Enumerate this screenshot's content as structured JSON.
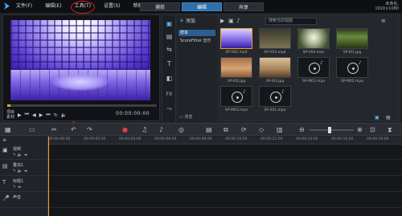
{
  "menu": [
    "文件(F)",
    "编辑(E)",
    "工具(T)",
    "设置(S)",
    "帮助(H)"
  ],
  "tabs": [
    "捕获",
    "编辑",
    "共享"
  ],
  "active_tab": "编辑",
  "title_right": [
    "未命名,",
    "1920×1080"
  ],
  "preview": {
    "labels": [
      "项目",
      "素材"
    ],
    "timecode": "00:00:00:00"
  },
  "library": {
    "add_label": "添加",
    "folders": [
      "样本",
      "ScoreFitter 音乐"
    ],
    "selected_folder": "样本",
    "browse_label": "浏览",
    "search_placeholder": "搜索当前视图",
    "items": [
      {
        "label": "SP-V02.mp4",
        "kind": "video"
      },
      {
        "label": "SP-V03.mp4",
        "kind": "video"
      },
      {
        "label": "SP-V04.mov",
        "kind": "video"
      },
      {
        "label": "SP-I01.jpg",
        "kind": "image"
      },
      {
        "label": "SP-I02.jpg",
        "kind": "image"
      },
      {
        "label": "SP-I03.jpg",
        "kind": "image"
      },
      {
        "label": "SP-M01.mpa",
        "kind": "audio"
      },
      {
        "label": "SP-M02.mpa",
        "kind": "audio"
      },
      {
        "label": "SP-M03.mpa",
        "kind": "audio"
      },
      {
        "label": "SP-S01.mpa",
        "kind": "audio"
      }
    ]
  },
  "timeline": {
    "ruler": [
      "00:00:00:00",
      "00:00:02:00",
      "00:00:04:00",
      "00:00:06:00",
      "00:00:08:00",
      "00:00:10:00",
      "00:00:12:00",
      "00:00:14:00",
      "00:00:16:00",
      "00:00:18:00"
    ],
    "tracks": [
      {
        "name": "视频",
        "icon": "video-track-icon"
      },
      {
        "name": "叠加1",
        "icon": "overlay-track-icon"
      },
      {
        "name": "标题1",
        "icon": "title-track-icon"
      },
      {
        "name": "声音",
        "icon": "voice-track-icon"
      }
    ]
  },
  "colors": {
    "accent": "#2f6fa8",
    "highlight": "#e9a425",
    "annotation": "#e0201e"
  }
}
